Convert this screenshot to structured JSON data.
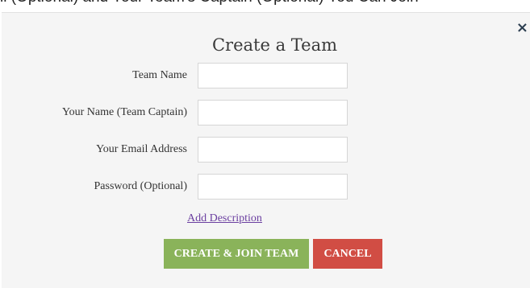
{
  "background_text": "ll (Optional) and Your Team's Captain (Optional) You Can Join",
  "modal": {
    "close_symbol": "×",
    "title": "Create a Team",
    "fields": [
      {
        "label": "Team Name",
        "value": "",
        "placeholder": ""
      },
      {
        "label": "Your Name (Team Captain)",
        "value": "",
        "placeholder": ""
      },
      {
        "label": "Your Email Address",
        "value": "",
        "placeholder": ""
      },
      {
        "label": "Password (Optional)",
        "value": "",
        "placeholder": ""
      }
    ],
    "add_description_link": "Add Description",
    "create_button": "CREATE & JOIN TEAM",
    "cancel_button": "CANCEL"
  },
  "colors": {
    "modal_background": "#f5f5f5",
    "create_button": "#8ab35a",
    "cancel_button": "#d14d44",
    "link": "#6b3fa0",
    "close_icon": "#2c3e50"
  }
}
